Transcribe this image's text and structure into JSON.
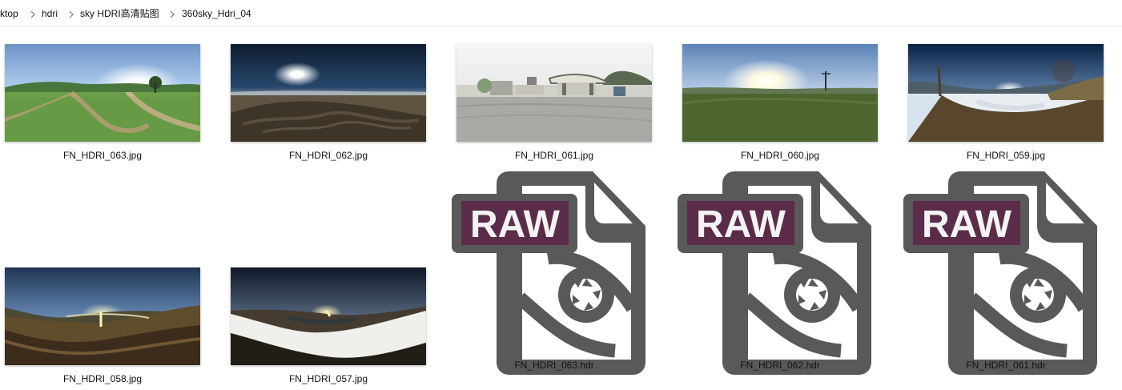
{
  "breadcrumb": {
    "items": [
      {
        "label": "ktop"
      },
      {
        "label": "hdri"
      },
      {
        "label": "sky HDRI高清贴图"
      },
      {
        "label": "360sky_Hdri_04"
      }
    ]
  },
  "files": [
    {
      "name": "FN_HDRI_063.jpg",
      "type": "image",
      "icon": "panorama-thumbnail-icon"
    },
    {
      "name": "FN_HDRI_062.jpg",
      "type": "image",
      "icon": "panorama-thumbnail-icon"
    },
    {
      "name": "FN_HDRI_061.jpg",
      "type": "image",
      "icon": "panorama-thumbnail-icon"
    },
    {
      "name": "FN_HDRI_060.jpg",
      "type": "image",
      "icon": "panorama-thumbnail-icon"
    },
    {
      "name": "FN_HDRI_059.jpg",
      "type": "image",
      "icon": "panorama-thumbnail-icon"
    },
    {
      "name": "FN_HDRI_058.jpg",
      "type": "image",
      "icon": "panorama-thumbnail-icon"
    },
    {
      "name": "FN_HDRI_057.jpg",
      "type": "image",
      "icon": "panorama-thumbnail-icon"
    },
    {
      "name": "FN_HDRI_063.hdr",
      "type": "raw",
      "icon": "raw-file-icon",
      "badge_text": "RAW"
    },
    {
      "name": "FN_HDRI_062.hdr",
      "type": "raw",
      "icon": "raw-file-icon",
      "badge_text": "RAW"
    },
    {
      "name": "FN_HDRI_061.hdr",
      "type": "raw",
      "icon": "raw-file-icon",
      "badge_text": "RAW"
    }
  ],
  "colors": {
    "raw_icon_gray": "#595959",
    "raw_badge_purple": "#5a2c49",
    "raw_badge_text": "#f3f3f3",
    "separator": "#dfe3e8"
  }
}
